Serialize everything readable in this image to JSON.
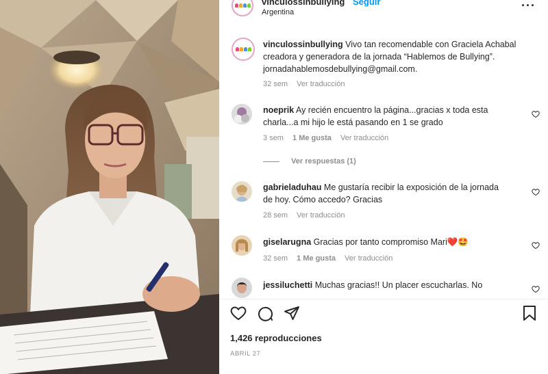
{
  "post": {
    "username": "vinculossinbullying",
    "follow_label": "Seguir",
    "location": "Argentina",
    "more_label": "···",
    "avatar_text": "Vínculos sin Bullying"
  },
  "caption": {
    "username": "vinculossinbullying",
    "text": "Vivo tan recomendable con Graciela Achabal creadora y generadora de la jornada “Hablemos de Bullying”. jornadahablemosdebullying@gmail.com.",
    "time": "32 sem",
    "translate": "Ver traducción"
  },
  "comments": [
    {
      "username": "noeprik",
      "text": "Ay recién encuentro la página...gracias x toda esta charla...a mi hijo le está pasando en 1 se grado",
      "time": "3 sem",
      "likes": "1 Me gusta",
      "translate": "Ver traducción",
      "replies": "Ver respuestas (1)"
    },
    {
      "username": "gabrieladuhau",
      "text": "Me gustaría recibir la exposición de la jornada de hoy. Cómo accedo? Gracias",
      "time": "28 sem",
      "translate": "Ver traducción"
    },
    {
      "username": "giselarugna",
      "text": "Gracias por tanto compromiso Mari❤️🤩",
      "time": "32 sem",
      "likes": "1 Me gusta",
      "translate": "Ver traducción"
    },
    {
      "username": "jessiluchetti",
      "text": "Muchas gracias!! Un placer escucharlas. No pude"
    }
  ],
  "footer": {
    "views": "1,426 reproducciones",
    "date": "ABRIL 27"
  },
  "colors": {
    "link_blue": "#0095f6",
    "muted": "#8e8e8e",
    "text": "#262626"
  },
  "icons": [
    "heart-icon",
    "comment-icon",
    "share-icon",
    "bookmark-icon",
    "more-icon"
  ]
}
